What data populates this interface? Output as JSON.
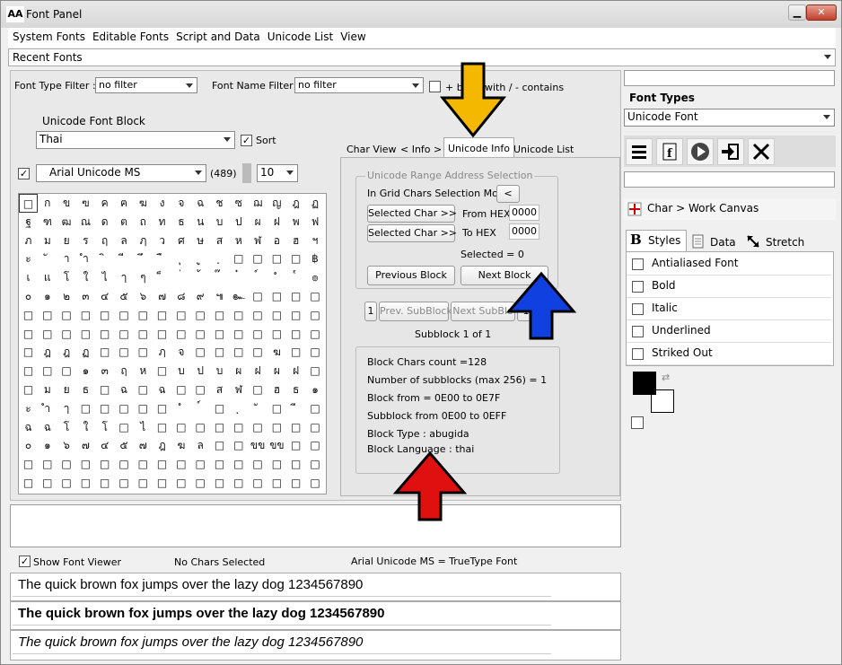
{
  "window": {
    "title": "Font Panel",
    "app_icon": "AA"
  },
  "menu": [
    "System Fonts",
    "Editable Fonts",
    "Script and Data",
    "Unicode List",
    "View"
  ],
  "recent_fonts": "Recent Fonts",
  "filters": {
    "font_type_label": "Font Type Filter :",
    "font_type_value": "no filter",
    "font_name_label": "Font Name Filter :",
    "font_name_value": "no filter",
    "begins_label": "+ be",
    "contains_label": "with / - contains"
  },
  "unicode_block": {
    "label": "Unicode Font Block",
    "value": "Thai",
    "sort_label": "Sort"
  },
  "font": {
    "name": "Arial Unicode MS",
    "count": "(489)",
    "size": "10"
  },
  "grid_rows": [
    [
      "□",
      "ก",
      "ข",
      "ฃ",
      "ค",
      "ฅ",
      "ฆ",
      "ง",
      "จ",
      "ฉ",
      "ช",
      "ซ",
      "ฌ",
      "ญ",
      "ฎ",
      "ฏ"
    ],
    [
      "ฐ",
      "ฑ",
      "ฒ",
      "ณ",
      "ด",
      "ต",
      "ถ",
      "ท",
      "ธ",
      "น",
      "บ",
      "ป",
      "ผ",
      "ฝ",
      "พ",
      "ฟ"
    ],
    [
      "ภ",
      "ม",
      "ย",
      "ร",
      "ฤ",
      "ล",
      "ฦ",
      "ว",
      "ศ",
      "ษ",
      "ส",
      "ห",
      "ฬ",
      "อ",
      "ฮ",
      "ฯ"
    ],
    [
      "ะ",
      "ั",
      "า",
      "ำ",
      "ิ",
      "ี",
      "ึ",
      "ื",
      "ุ",
      "ู",
      "ฺ",
      "□",
      "□",
      "□",
      "□",
      "฿"
    ],
    [
      "เ",
      "แ",
      "โ",
      "ใ",
      "ไ",
      "ๅ",
      "ๆ",
      "็",
      "่",
      "้",
      "๊",
      "๋",
      "์",
      "ํ",
      "๎",
      "๏"
    ],
    [
      "๐",
      "๑",
      "๒",
      "๓",
      "๔",
      "๕",
      "๖",
      "๗",
      "๘",
      "๙",
      "๚",
      "๛",
      "□",
      "□",
      "□",
      "□"
    ],
    [
      "□",
      "□",
      "□",
      "□",
      "□",
      "□",
      "□",
      "□",
      "□",
      "□",
      "□",
      "□",
      "□",
      "□",
      "□",
      "□"
    ],
    [
      "□",
      "□",
      "□",
      "□",
      "□",
      "□",
      "□",
      "□",
      "□",
      "□",
      "□",
      "□",
      "□",
      "□",
      "□",
      "□"
    ],
    [
      "□",
      "ฎ",
      "ฎ",
      "ฏ",
      "□",
      "□",
      "□",
      "ฦ",
      "จ",
      "□",
      "□",
      "□",
      "□",
      "ฆ",
      "□",
      "□"
    ],
    [
      "□",
      "□",
      "□",
      "๑",
      "๓",
      "ฤ",
      "ห",
      "□",
      "บ",
      "ป",
      "บ",
      "ผ",
      "ฝ",
      "ผ",
      "ฝ",
      "□"
    ],
    [
      "□",
      "ม",
      "ย",
      "ธ",
      "□",
      "ฉ",
      "□",
      "ฉ",
      "□",
      "□",
      "ส",
      "ฬ",
      "□",
      "ฮ",
      "ธ",
      "๑"
    ],
    [
      "ะ",
      "ำ",
      "ๅ",
      "□",
      "□",
      "□",
      "□",
      "□",
      "ํ",
      "์",
      "□",
      "ฺ",
      "ั",
      "□",
      "ี",
      "□"
    ],
    [
      "ฉ",
      "ฉ",
      "โ",
      "ใ",
      "โ",
      "□",
      "ไ",
      "□",
      "□",
      "□",
      "□",
      "□",
      "□",
      "□",
      "□",
      "□"
    ],
    [
      "๐",
      "๑",
      "๖",
      "๗",
      "๔",
      "๕",
      "๗",
      "ฎ",
      "ฆ",
      "ล",
      "□",
      "□",
      "ขข",
      "ขข",
      "□",
      "□"
    ],
    [
      "□",
      "□",
      "□",
      "□",
      "□",
      "□",
      "□",
      "□",
      "□",
      "□",
      "□",
      "□",
      "□",
      "□",
      "□",
      "□"
    ],
    [
      "□",
      "□",
      "□",
      "□",
      "□",
      "□",
      "□",
      "□",
      "□",
      "□",
      "□",
      "□",
      "□",
      "□",
      "□",
      "□"
    ]
  ],
  "tabs": [
    "Char View",
    "< Info >",
    "Unicode Info",
    "Unicode List"
  ],
  "range": {
    "title": "Unicode Range Address Selection",
    "grid_mode_label": "In Grid Chars Selection Mode",
    "grid_mode_btn": "<",
    "sel_char_btn": "Selected Char >>",
    "from_label": "From HEX",
    "from_value": "0000",
    "to_label": "To HEX",
    "to_value": "0000",
    "selected": "Selected = 0",
    "prev_block": "Previous Block",
    "next_block": "Next Block"
  },
  "subblock": {
    "num": "1",
    "prev": "Prev. SubBlock",
    "next": "Next SubBlo",
    "last": "1",
    "status": "Subblock 1 of 1"
  },
  "block_info": [
    "Block Chars count =128",
    "Number of subblocks (max 256)  = 1",
    "Block from = 0E00 to 0E7F",
    "Subblock from 0E00 to 0EFF",
    "Block Type : abugida",
    "Block Language : thai"
  ],
  "status": {
    "show_viewer": "Show Font Viewer",
    "no_chars": "No Chars Selected",
    "font_type": "Arial Unicode MS = TrueType Font"
  },
  "samples": [
    "The quick brown fox jumps over the lazy dog 1234567890",
    "The quick brown fox jumps over the lazy dog 1234567890",
    "The quick brown fox jumps over the lazy dog 1234567890"
  ],
  "right": {
    "font_types_label": "Font Types",
    "font_types_value": "Unicode Font",
    "char_work_canvas": "Char > Work Canvas",
    "tabs": [
      "Styles",
      "Data",
      "Stretch"
    ],
    "styles": [
      "Antialiased Font",
      "Bold",
      "Italic",
      "Underlined",
      "Striked Out"
    ]
  },
  "colors": {
    "fg": "#000000",
    "bg": "#ffffff",
    "arrow_yellow": "#f5b800",
    "arrow_blue": "#1040e0",
    "arrow_red": "#e01010"
  }
}
